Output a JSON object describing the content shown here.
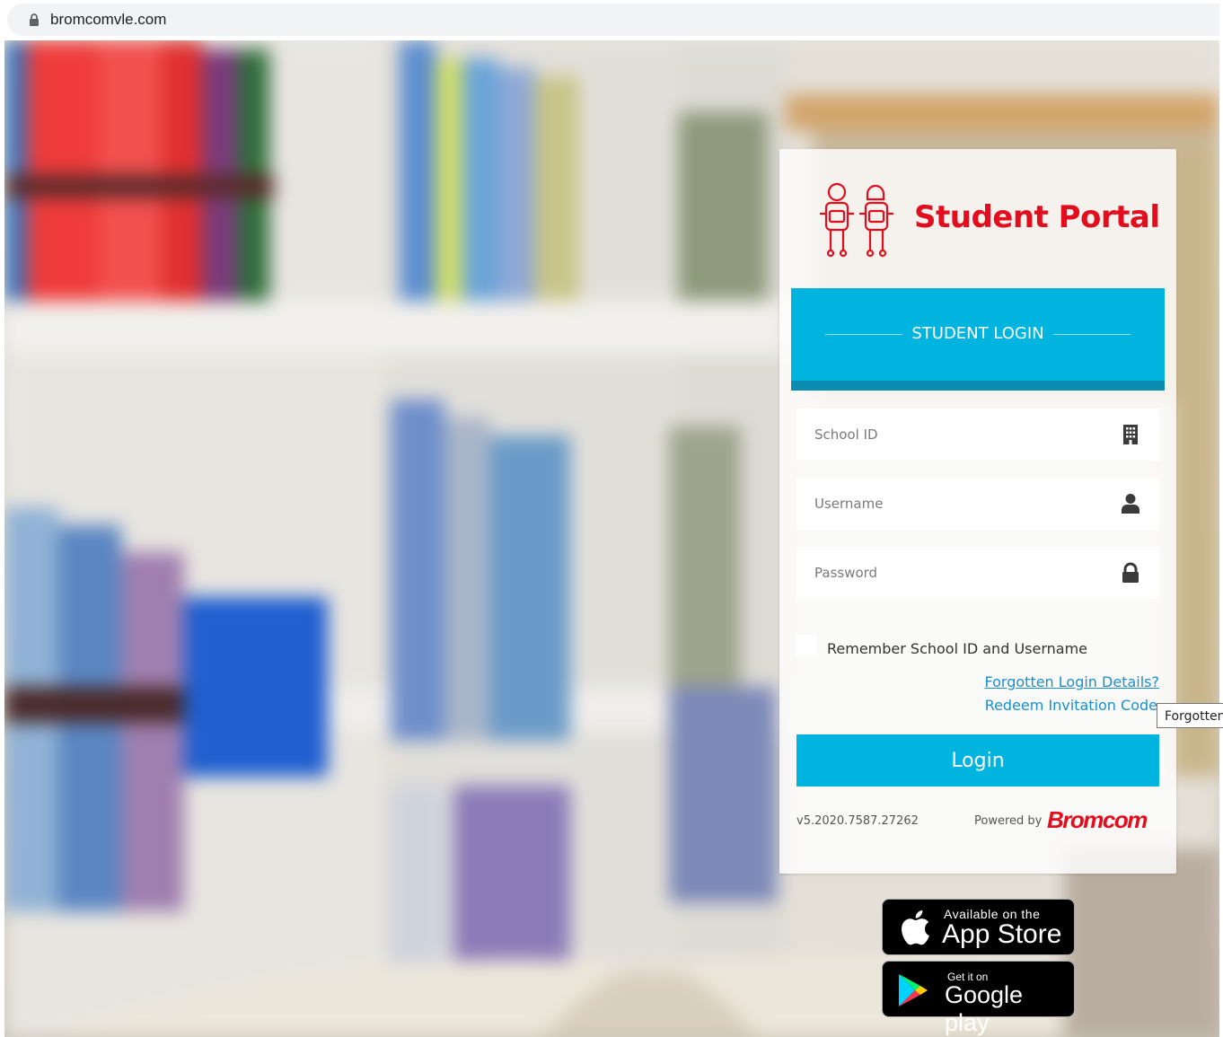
{
  "browser": {
    "url": "bromcomvle.com"
  },
  "header": {
    "title": "Student Portal"
  },
  "banner": {
    "label": "STUDENT LOGIN"
  },
  "form": {
    "school_id_placeholder": "School ID",
    "username_placeholder": "Username",
    "password_placeholder": "Password",
    "remember_label": "Remember School ID and Username",
    "forgotten_link": "Forgotten Login Details?",
    "redeem_link": "Redeem Invitation Code",
    "login_button": "Login"
  },
  "tooltip": {
    "text": "Forgotten"
  },
  "footer": {
    "version": "v5.2020.7587.27262",
    "powered_by": "Powered by",
    "brand": "Bromcom"
  },
  "badges": {
    "appstore_small": "Available on the",
    "appstore_big": "App Store",
    "googleplay_small": "Get it on",
    "googleplay_big": "Google play"
  },
  "colors": {
    "brand_red": "#e30d1e",
    "accent_blue": "#00b4e0",
    "link_blue": "#1a8fd0"
  },
  "icons": [
    "lock-icon",
    "students-logo-icon",
    "building-icon",
    "user-icon",
    "padlock-icon",
    "apple-icon",
    "google-play-icon"
  ]
}
